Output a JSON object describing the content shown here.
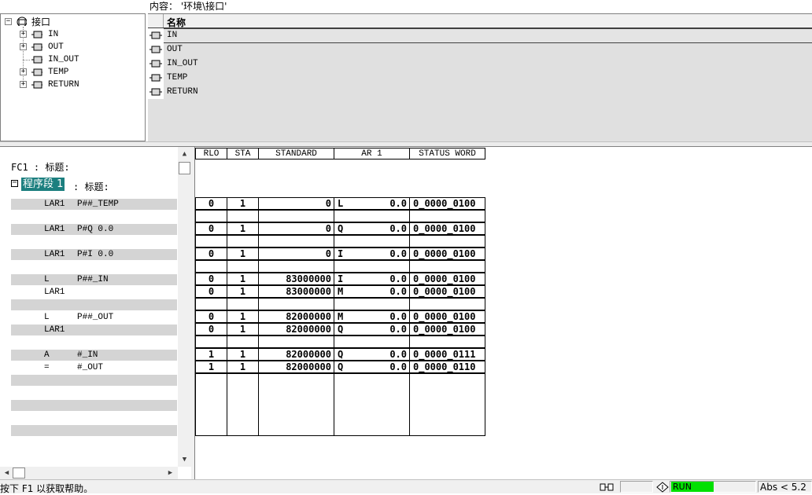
{
  "content_path": "内容： '环境\\接口'",
  "tree": {
    "root": "接口",
    "items": [
      {
        "label": "IN",
        "expandable": true
      },
      {
        "label": "OUT",
        "expandable": true
      },
      {
        "label": "IN_OUT",
        "expandable": false
      },
      {
        "label": "TEMP",
        "expandable": true
      },
      {
        "label": "RETURN",
        "expandable": true
      }
    ]
  },
  "detail": {
    "column_name": "名称",
    "rows": [
      {
        "label": "IN",
        "selected": true
      },
      {
        "label": "OUT",
        "selected": false
      },
      {
        "label": "IN_OUT",
        "selected": false
      },
      {
        "label": "TEMP",
        "selected": false
      },
      {
        "label": "RETURN",
        "selected": false
      }
    ]
  },
  "code": {
    "block_title": "FC1 : 标题:",
    "network_label": "程序段 1",
    "network_title_rest": ": 标题:",
    "lines": [
      {
        "op": "LAR1",
        "arg": "P##_TEMP"
      },
      {
        "op": "",
        "arg": ""
      },
      {
        "op": "LAR1",
        "arg": "P#Q 0.0"
      },
      {
        "op": "",
        "arg": ""
      },
      {
        "op": "LAR1",
        "arg": "P#I 0.0"
      },
      {
        "op": "",
        "arg": ""
      },
      {
        "op": "L",
        "arg": "P##_IN"
      },
      {
        "op": "LAR1",
        "arg": ""
      },
      {
        "op": "",
        "arg": ""
      },
      {
        "op": "L",
        "arg": "P##_OUT"
      },
      {
        "op": "LAR1",
        "arg": ""
      },
      {
        "op": "",
        "arg": ""
      },
      {
        "op": "A",
        "arg": "#_IN"
      },
      {
        "op": "=",
        "arg": "#_OUT"
      },
      {
        "op": "",
        "arg": ""
      },
      {
        "op": "",
        "arg": ""
      },
      {
        "op": "",
        "arg": ""
      },
      {
        "op": "",
        "arg": ""
      },
      {
        "op": "",
        "arg": ""
      }
    ]
  },
  "status_table": {
    "headers": [
      "RLO",
      "STA",
      "STANDARD",
      "AR 1",
      "STATUS WORD"
    ],
    "rows": [
      {
        "rlo": "0",
        "sta": "1",
        "standard": "0",
        "ar1_area": "L",
        "ar1_value": "0.0",
        "status_word": "0_0000_0100"
      },
      null,
      {
        "rlo": "0",
        "sta": "1",
        "standard": "0",
        "ar1_area": "Q",
        "ar1_value": "0.0",
        "status_word": "0_0000_0100"
      },
      null,
      {
        "rlo": "0",
        "sta": "1",
        "standard": "0",
        "ar1_area": "I",
        "ar1_value": "0.0",
        "status_word": "0_0000_0100"
      },
      null,
      {
        "rlo": "0",
        "sta": "1",
        "standard": "83000000",
        "ar1_area": "I",
        "ar1_value": "0.0",
        "status_word": "0_0000_0100"
      },
      {
        "rlo": "0",
        "sta": "1",
        "standard": "83000000",
        "ar1_area": "M",
        "ar1_value": "0.0",
        "status_word": "0_0000_0100"
      },
      null,
      {
        "rlo": "0",
        "sta": "1",
        "standard": "82000000",
        "ar1_area": "M",
        "ar1_value": "0.0",
        "status_word": "0_0000_0100"
      },
      {
        "rlo": "0",
        "sta": "1",
        "standard": "82000000",
        "ar1_area": "Q",
        "ar1_value": "0.0",
        "status_word": "0_0000_0100"
      },
      null,
      {
        "rlo": "1",
        "sta": "1",
        "standard": "82000000",
        "ar1_area": "Q",
        "ar1_value": "0.0",
        "status_word": "0_0000_0111"
      },
      {
        "rlo": "1",
        "sta": "1",
        "standard": "82000000",
        "ar1_area": "Q",
        "ar1_value": "0.0",
        "status_word": "0_0000_0110"
      }
    ]
  },
  "status_bar": {
    "help_text": "按下 F1 以获取帮助。",
    "run_state": "RUN",
    "run_color": "#00e000",
    "abs_text": "Abs < 5.2"
  }
}
